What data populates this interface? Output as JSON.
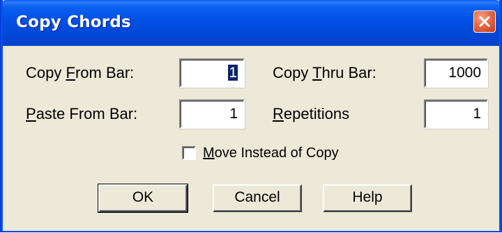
{
  "window": {
    "title": "Copy Chords"
  },
  "fields": {
    "copy_from": {
      "label_pre": "Copy ",
      "label_key": "F",
      "label_post": "rom Bar:",
      "value": "1"
    },
    "copy_thru": {
      "label_pre": "Copy ",
      "label_key": "T",
      "label_post": "hru Bar:",
      "value": "1000"
    },
    "paste_from": {
      "label_pre": "",
      "label_key": "P",
      "label_post": "aste From Bar:",
      "value": "1"
    },
    "repetitions": {
      "label_pre": "",
      "label_key": "R",
      "label_post": "epetitions",
      "value": "1"
    }
  },
  "move_checkbox": {
    "label_key": "M",
    "label_post": "ove Instead of Copy",
    "checked": false
  },
  "buttons": {
    "ok": "OK",
    "cancel": "Cancel",
    "help": "Help"
  },
  "icons": {
    "close": "close-icon"
  },
  "colors": {
    "titlebar": "#0054e3",
    "close_button": "#e26a45",
    "dialog_face": "#ece9d8",
    "selection": "#0a246a"
  }
}
